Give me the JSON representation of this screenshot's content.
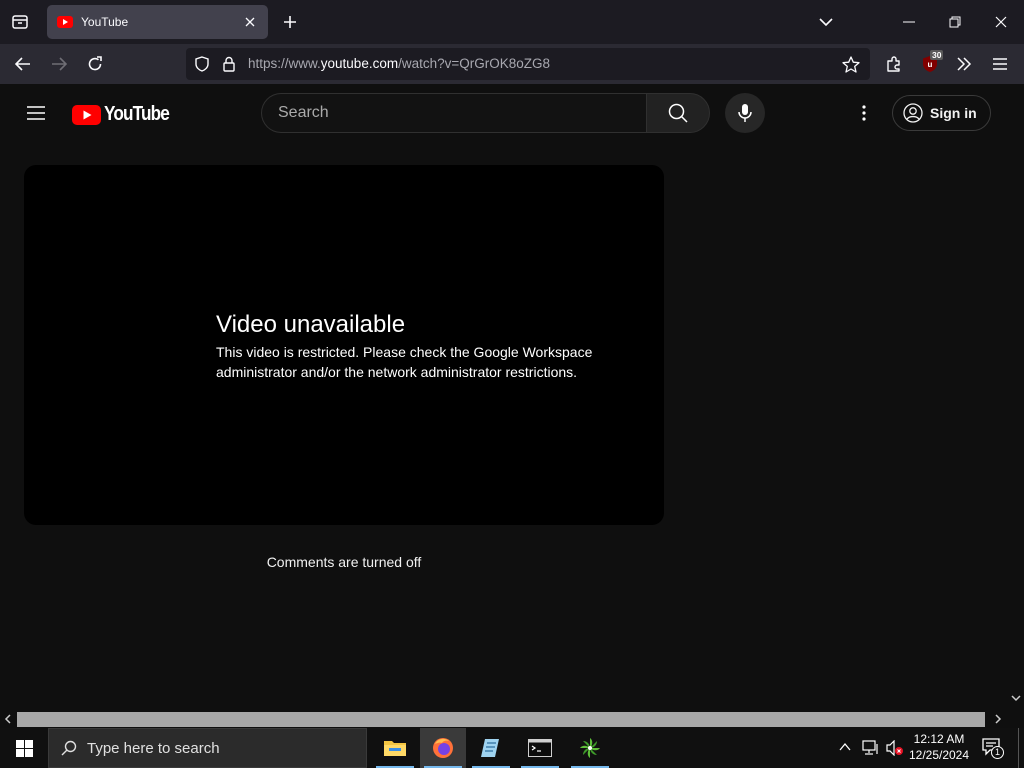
{
  "browser": {
    "tab_title": "YouTube",
    "url_prefix": "https://www.",
    "url_host": "youtube.com",
    "url_path": "/watch?v=QrGrOK8oZG8",
    "ublock_badge": "30"
  },
  "youtube": {
    "logo_text": "YouTube",
    "search_placeholder": "Search",
    "signin_label": "Sign in",
    "error_title": "Video unavailable",
    "error_message": "This video is restricted. Please check the Google Workspace administrator and/or the network administrator restrictions.",
    "comments_status": "Comments are turned off",
    "brand_color": "#ff0000"
  },
  "taskbar": {
    "search_placeholder": "Type here to search",
    "time": "12:12 AM",
    "date": "12/25/2024",
    "notification_count": "1",
    "apps": [
      "file-explorer",
      "firefox",
      "notepad",
      "terminal",
      "leaf-app"
    ]
  }
}
